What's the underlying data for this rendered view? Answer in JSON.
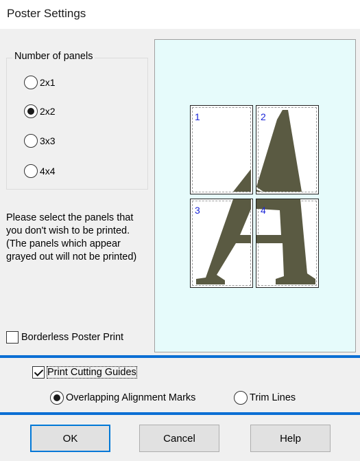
{
  "window": {
    "title": "Poster Settings"
  },
  "number_of_panels": {
    "label": "Number of panels",
    "options": [
      {
        "label": "2x1",
        "selected": false
      },
      {
        "label": "2x2",
        "selected": true
      },
      {
        "label": "3x3",
        "selected": false
      },
      {
        "label": "4x4",
        "selected": false
      }
    ]
  },
  "instructions": "Please select the panels that you don't wish to be printed. (The panels which appear grayed out will not be printed)",
  "borderless": {
    "label": "Borderless Poster Print",
    "checked": false
  },
  "preview": {
    "background": "#e6fbfb",
    "letter_color": "#5a5a42",
    "panels": [
      "1",
      "2",
      "3",
      "4"
    ]
  },
  "cutting_guides": {
    "label": "Print Cutting Guides",
    "checked": true,
    "options": [
      {
        "label": "Overlapping Alignment Marks",
        "selected": true
      },
      {
        "label": "Trim Lines",
        "selected": false
      }
    ]
  },
  "buttons": {
    "ok": "OK",
    "cancel": "Cancel",
    "help": "Help"
  },
  "colors": {
    "accent": "#0b6fd4",
    "panel_number": "#1a25d8"
  }
}
